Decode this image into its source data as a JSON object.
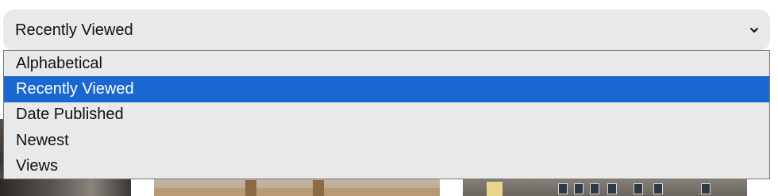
{
  "select": {
    "current_value": "Recently Viewed",
    "chevron_icon": "chevron-down-icon"
  },
  "dropdown": {
    "options": [
      {
        "label": "Alphabetical",
        "selected": false
      },
      {
        "label": "Recently Viewed",
        "selected": true
      },
      {
        "label": "Date Published",
        "selected": false
      },
      {
        "label": "Newest",
        "selected": false
      },
      {
        "label": "Views",
        "selected": false
      }
    ],
    "highlight_color": "#1a67d2"
  },
  "background": {
    "thumbnails": [
      "thumbnail-image",
      "thumbnail-image",
      "thumbnail-image"
    ]
  }
}
